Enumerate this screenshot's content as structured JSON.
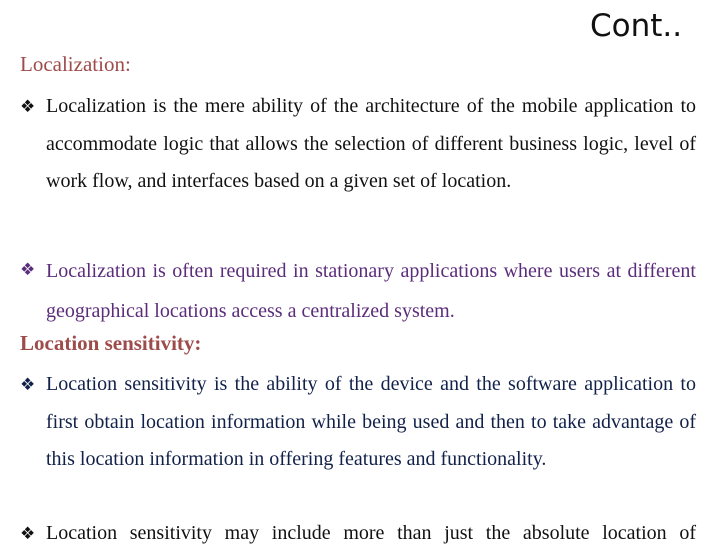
{
  "slide": {
    "title": "Cont..",
    "colors": {
      "heading": "#9E4B4B",
      "bullet1_text": "#111111",
      "bullet2_text": "#5B2C7A",
      "bullet3_text": "#12214A",
      "bullet4_text": "#111111"
    },
    "bullet_icon": "four-diamond-bullet",
    "bullet_glyph": "❖",
    "sections": [
      {
        "heading": "Localization:",
        "bullets": [
          "Localization is the mere ability of the architecture of the mobile application  to accommodate logic that allows the selection of different business logic, level of work flow, and interfaces based on a given set of location.",
          "Localization is often required in stationary applications where users at different geographical locations access a centralized system."
        ]
      },
      {
        "heading": "Location sensitivity:",
        "bullets": [
          "Location sensitivity is the ability of the device and the software application to first obtain location information while being used and then to take advantage of this location information in offering features and functionality.",
          "Location sensitivity may include more than just the absolute location of"
        ]
      }
    ]
  }
}
